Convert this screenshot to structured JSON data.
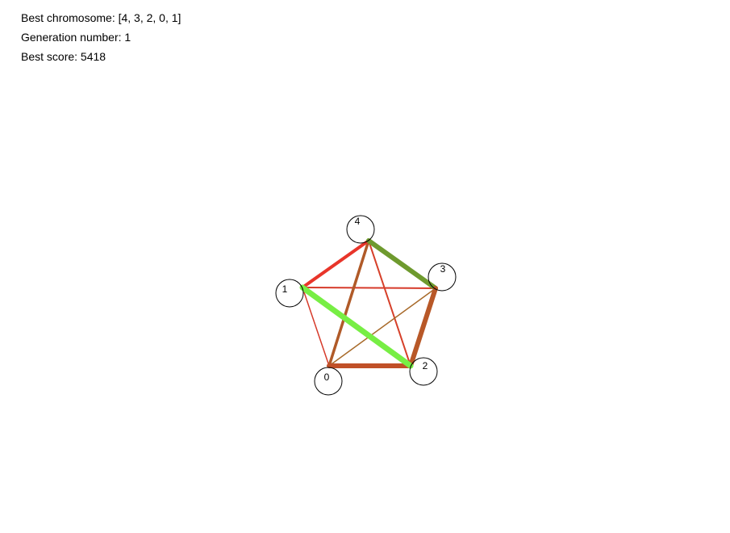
{
  "info": {
    "best_chromosome": "Best chromosome: [4, 3, 2, 0, 1]",
    "generation": "Generation number: 1",
    "best_score": "Best score: 5418"
  },
  "graph": {
    "nodes": [
      {
        "id": 0,
        "label": "0"
      },
      {
        "id": 1,
        "label": "1"
      },
      {
        "id": 2,
        "label": "2"
      },
      {
        "id": 3,
        "label": "3"
      },
      {
        "id": 4,
        "label": "4"
      }
    ],
    "edges": [
      {
        "from": 1,
        "to": 3,
        "color": "#d63a2a",
        "weight": 2
      },
      {
        "from": 4,
        "to": 2,
        "color": "#d6402a",
        "weight": 2
      },
      {
        "from": 1,
        "to": 0,
        "color": "#d63a2a",
        "weight": 1.5
      },
      {
        "from": 0,
        "to": 3,
        "color": "#a86a2a",
        "weight": 1.5
      },
      {
        "from": 0,
        "to": 4,
        "color": "#b05a28",
        "weight": 3.5
      },
      {
        "from": 1,
        "to": 4,
        "color": "#e8352a",
        "weight": 4
      },
      {
        "from": 4,
        "to": 3,
        "color": "#6e9a2e",
        "weight": 6
      },
      {
        "from": 3,
        "to": 2,
        "color": "#b85828",
        "weight": 6
      },
      {
        "from": 0,
        "to": 2,
        "color": "#c05028",
        "weight": 6
      },
      {
        "from": 1,
        "to": 2,
        "color": "#77ee44",
        "weight": 7
      }
    ]
  }
}
